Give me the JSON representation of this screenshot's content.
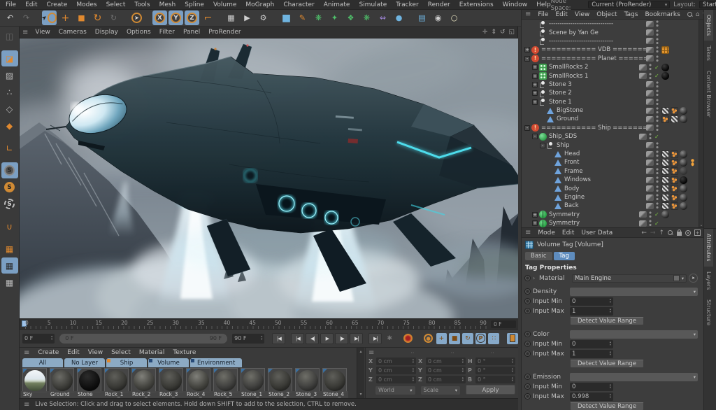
{
  "menubar": {
    "items": [
      "File",
      "Edit",
      "Create",
      "Modes",
      "Select",
      "Tools",
      "Mesh",
      "Spline",
      "Volume",
      "MoGraph",
      "Character",
      "Animate",
      "Simulate",
      "Tracker",
      "Render",
      "Extensions",
      "Window",
      "Help"
    ],
    "node_space_label": "Node Space:",
    "node_space_value": "Current (ProRender)",
    "layout_label": "Layout:",
    "layout_value": "Startup"
  },
  "toolbar": {
    "items": [
      {
        "name": "undo-icon",
        "glyph": "↶",
        "cls": ""
      },
      {
        "name": "redo-icon",
        "glyph": "↷",
        "cls": "dim"
      },
      {
        "name": "live-selection-icon",
        "glyph": "",
        "cls": "sel hl ring gap"
      },
      {
        "name": "move-icon",
        "glyph": "+",
        "cls": "org big"
      },
      {
        "name": "scale-icon",
        "glyph": "■",
        "cls": "org"
      },
      {
        "name": "rotate-icon",
        "glyph": "↻",
        "cls": "org big"
      },
      {
        "name": "last-used-tool-icon",
        "glyph": "↻",
        "cls": "dim"
      },
      {
        "name": "selection-tool-icon",
        "glyph": "➤",
        "cls": "ring gap"
      },
      {
        "name": "axis-x-lock-icon",
        "glyph": "X",
        "cls": "axis hl gap"
      },
      {
        "name": "axis-y-lock-icon",
        "glyph": "Y",
        "cls": "axis hl"
      },
      {
        "name": "axis-z-lock-icon",
        "glyph": "Z",
        "cls": "axis hl"
      },
      {
        "name": "coordinate-system-icon",
        "glyph": "⌐",
        "cls": "org big"
      },
      {
        "name": "render-view-icon",
        "glyph": "▦",
        "cls": "gap"
      },
      {
        "name": "render-picture-viewer-icon",
        "glyph": "▶",
        "cls": ""
      },
      {
        "name": "render-settings-icon",
        "glyph": "⚙",
        "cls": ""
      },
      {
        "name": "primitive-cube-icon",
        "glyph": "■",
        "cls": "blue big gap"
      },
      {
        "name": "spline-pen-icon",
        "glyph": "✎",
        "cls": "org"
      },
      {
        "name": "subdivision-surface-icon",
        "glyph": "❋",
        "cls": "green"
      },
      {
        "name": "generator-icon",
        "glyph": "✦",
        "cls": "green"
      },
      {
        "name": "deformer-icon",
        "glyph": "❖",
        "cls": "green"
      },
      {
        "name": "cloner-icon",
        "glyph": "❋",
        "cls": "green"
      },
      {
        "name": "symmetry-icon",
        "glyph": "⇔",
        "cls": "purple"
      },
      {
        "name": "volume-icon",
        "glyph": "●",
        "cls": "blue"
      },
      {
        "name": "floor-icon",
        "glyph": "▤",
        "cls": "blue gap"
      },
      {
        "name": "camera-icon",
        "glyph": "◉",
        "cls": ""
      },
      {
        "name": "light-icon",
        "glyph": "○",
        "cls": "ylw"
      }
    ]
  },
  "leftbar": {
    "items": [
      {
        "name": "make-editable-icon",
        "glyph": "◫",
        "cls": "dim"
      },
      {
        "name": "model-mode-icon",
        "glyph": "◪",
        "cls": "hl org sp"
      },
      {
        "name": "texture-mode-icon",
        "glyph": "▨",
        "cls": ""
      },
      {
        "name": "point-mode-icon",
        "glyph": "∴",
        "cls": ""
      },
      {
        "name": "edge-mode-icon",
        "glyph": "◇",
        "cls": ""
      },
      {
        "name": "polygon-mode-icon",
        "glyph": "◆",
        "cls": "org"
      },
      {
        "name": "axis-mode-icon",
        "glyph": "∟",
        "cls": "org sp"
      },
      {
        "name": "snap-enable-icon",
        "glyph": "S",
        "cls": "ringS hl sp"
      },
      {
        "name": "snap-modes-icon",
        "glyph": "S",
        "cls": "ringS org"
      },
      {
        "name": "snap-dynamic-icon",
        "glyph": "S",
        "cls": "ringS dash"
      },
      {
        "name": "magnet-icon",
        "glyph": "∪",
        "cls": "org sp"
      },
      {
        "name": "workplane-icon",
        "glyph": "▦",
        "cls": "org sp"
      },
      {
        "name": "locked-workplane-icon",
        "glyph": "▦",
        "cls": "hl"
      },
      {
        "name": "dynamic-workplane-icon",
        "glyph": "▦",
        "cls": ""
      }
    ]
  },
  "viewport": {
    "menu": [
      "View",
      "Cameras",
      "Display",
      "Options",
      "Filter",
      "Panel",
      "ProRender"
    ],
    "corner_icons": [
      {
        "name": "pan-view-icon",
        "glyph": "✛"
      },
      {
        "name": "dolly-view-icon",
        "glyph": "⇕"
      },
      {
        "name": "rotate-view-icon",
        "glyph": "↺"
      },
      {
        "name": "toggle-view-icon",
        "glyph": "◱"
      }
    ]
  },
  "objects": {
    "menu": [
      "File",
      "Edit",
      "View",
      "Object",
      "Tags",
      "Bookmarks"
    ],
    "tree": [
      {
        "ind": "ind-1",
        "expand": "",
        "icon": "ico-null",
        "label": "------------------------------",
        "check": false,
        "tags": []
      },
      {
        "ind": "ind-1",
        "expand": "",
        "icon": "ico-null",
        "label": "Scene by Yan Ge",
        "check": false,
        "tags": []
      },
      {
        "ind": "ind-1",
        "expand": "",
        "icon": "ico-null",
        "label": "------------------------------",
        "check": false,
        "tags": []
      },
      {
        "ind": "ind-0",
        "expand": "+",
        "icon": "ico-bang",
        "label": "=========== VDB ============",
        "check": false,
        "tags": [
          "tag-vol"
        ]
      },
      {
        "ind": "ind-0",
        "expand": "-",
        "icon": "ico-bang",
        "label": "=========== Planet ============",
        "check": false,
        "tags": []
      },
      {
        "ind": "ind-1",
        "expand": "+",
        "icon": "ico-cloner",
        "label": "SmallRocks 2",
        "check": true,
        "tags": [
          "tag-sphere-dark"
        ]
      },
      {
        "ind": "ind-1",
        "expand": "+",
        "icon": "ico-cloner",
        "label": "SmallRocks 1",
        "check": true,
        "tags": [
          "tag-sphere-dark"
        ]
      },
      {
        "ind": "ind-1",
        "expand": "+",
        "icon": "ico-null",
        "label": "Stone 3",
        "check": false,
        "tags": []
      },
      {
        "ind": "ind-1",
        "expand": "+",
        "icon": "ico-null",
        "label": "Stone 2",
        "check": false,
        "tags": []
      },
      {
        "ind": "ind-1",
        "expand": "+",
        "icon": "ico-null",
        "label": "Stone 1",
        "check": false,
        "tags": []
      },
      {
        "ind": "ind-2",
        "expand": "",
        "icon": "ico-poly",
        "label": "BigStone",
        "check": false,
        "tags": [
          "tag-checker",
          "tag-odots",
          "tag-sphere"
        ]
      },
      {
        "ind": "ind-2",
        "expand": "",
        "icon": "ico-poly",
        "label": "Ground",
        "check": false,
        "tags": [
          "tag-odots",
          "tag-checker",
          "tag-sphere"
        ]
      },
      {
        "ind": "ind-0",
        "expand": "-",
        "icon": "ico-bang",
        "label": "=========== Ship ============",
        "check": false,
        "tags": []
      },
      {
        "ind": "ind-1",
        "expand": "-",
        "icon": "ico-sds",
        "label": "Ship_SDS",
        "check": true,
        "tags": []
      },
      {
        "ind": "ind-2",
        "expand": "-",
        "icon": "ico-null",
        "label": "Ship",
        "check": false,
        "tags": []
      },
      {
        "ind": "ind-3",
        "expand": "",
        "icon": "ico-poly",
        "label": "Head",
        "check": false,
        "tags": [
          "tag-checker",
          "tag-odots",
          "tag-sphere"
        ]
      },
      {
        "ind": "ind-3",
        "expand": "",
        "icon": "ico-poly",
        "label": "Front",
        "check": false,
        "tags": [
          "tag-checker",
          "tag-odots",
          "tag-sphere",
          "tag-figure"
        ]
      },
      {
        "ind": "ind-3",
        "expand": "",
        "icon": "ico-poly",
        "label": "Frame",
        "check": false,
        "tags": [
          "tag-checker",
          "tag-odots",
          "tag-sphere-dim"
        ]
      },
      {
        "ind": "ind-3",
        "expand": "",
        "icon": "ico-poly",
        "label": "Windows",
        "check": false,
        "tags": [
          "tag-checker",
          "tag-odots",
          "tag-sphere-dark"
        ]
      },
      {
        "ind": "ind-3",
        "expand": "",
        "icon": "ico-poly",
        "label": "Body",
        "check": false,
        "tags": [
          "tag-checker",
          "tag-odots",
          "tag-sphere"
        ]
      },
      {
        "ind": "ind-3",
        "expand": "",
        "icon": "ico-poly",
        "label": "Engine",
        "check": false,
        "tags": [
          "tag-checker",
          "tag-odots",
          "tag-sphere"
        ]
      },
      {
        "ind": "ind-3",
        "expand": "",
        "icon": "ico-poly",
        "label": "Back",
        "check": false,
        "tags": [
          "tag-checker",
          "tag-odots",
          "tag-sphere"
        ]
      },
      {
        "ind": "ind-1",
        "expand": "+",
        "icon": "ico-sym",
        "label": "Symmetry",
        "check": true,
        "tags": [
          "tag-sphere"
        ]
      },
      {
        "ind": "ind-1",
        "expand": "+",
        "icon": "ico-sym",
        "label": "Symmetry",
        "check": true,
        "tags": []
      }
    ]
  },
  "attributes": {
    "menu": [
      "Mode",
      "Edit",
      "User Data"
    ],
    "title": "Volume Tag [Volume]",
    "tab_basic": "Basic",
    "tab_tag": "Tag",
    "section": "Tag Properties",
    "rows": [
      {
        "kind": "material",
        "label": "Material",
        "value": "Main Engine",
        "radio": true,
        "arrow": true,
        "gap": false
      },
      {
        "kind": "select",
        "label": "Density",
        "radio": true,
        "gap": true
      },
      {
        "kind": "number",
        "label": "Input Min",
        "value": "0",
        "radio": true,
        "gap": false
      },
      {
        "kind": "number",
        "label": "Input Max",
        "value": "1",
        "radio": true,
        "gap": false
      },
      {
        "kind": "button",
        "value": "Detect Value Range",
        "gap": false
      },
      {
        "kind": "select",
        "label": "Color",
        "radio": true,
        "gap": true
      },
      {
        "kind": "number",
        "label": "Input Min",
        "value": "0",
        "radio": true,
        "gap": false
      },
      {
        "kind": "number",
        "label": "Input Max",
        "value": "1",
        "radio": true,
        "gap": false
      },
      {
        "kind": "button",
        "value": "Detect Value Range",
        "gap": false
      },
      {
        "kind": "select",
        "label": "Emission",
        "radio": true,
        "gap": true
      },
      {
        "kind": "number",
        "label": "Input Min",
        "value": "0",
        "radio": true,
        "gap": false
      },
      {
        "kind": "number",
        "label": "Input Max",
        "value": "0.998",
        "radio": true,
        "gap": false
      },
      {
        "kind": "button",
        "value": "Detect Value Range",
        "gap": false
      }
    ]
  },
  "timeline": {
    "labels": [
      "0",
      "5",
      "10",
      "15",
      "20",
      "25",
      "30",
      "35",
      "40",
      "45",
      "50",
      "55",
      "60",
      "65",
      "70",
      "75",
      "80",
      "85",
      "90"
    ],
    "end_field": "0 F",
    "current": "0 F",
    "range_start": "0 F",
    "range_end": "90 F",
    "range_field": "90 F"
  },
  "transport": [
    {
      "name": "go-to-start-button",
      "glyph": "|◀",
      "cls": "first"
    },
    {
      "name": "previous-key-button",
      "glyph": "|◀",
      "cls": ""
    },
    {
      "name": "previous-frame-button",
      "glyph": "◀|",
      "cls": ""
    },
    {
      "name": "play-button",
      "glyph": "▶",
      "cls": ""
    },
    {
      "name": "next-frame-button",
      "glyph": "|▶",
      "cls": ""
    },
    {
      "name": "next-key-button",
      "glyph": "▶|",
      "cls": ""
    },
    {
      "name": "go-to-end-button",
      "glyph": "▶|",
      "cls": "last"
    }
  ],
  "materials": {
    "menu": [
      "Create",
      "Edit",
      "View",
      "Select",
      "Material",
      "Texture"
    ],
    "layers": [
      {
        "label": "All",
        "marker": ""
      },
      {
        "label": "No Layer",
        "marker": ""
      },
      {
        "label": "Ship",
        "marker": "org"
      },
      {
        "label": "Volume",
        "marker": "blue"
      },
      {
        "label": "Environment",
        "marker": "blue"
      }
    ],
    "items": [
      {
        "name": "Sky",
        "cls": "mat-sky"
      },
      {
        "name": "Ground",
        "cls": "mat-dark"
      },
      {
        "name": "Stone",
        "cls": "mat-black"
      },
      {
        "name": "Rock_1",
        "cls": "mat-rock-b"
      },
      {
        "name": "Rock_2",
        "cls": "mat-rock-a"
      },
      {
        "name": "Rock_3",
        "cls": "mat-rock-b"
      },
      {
        "name": "Rock_4",
        "cls": "mat-rock-a"
      },
      {
        "name": "Rock_5",
        "cls": "mat-rock-c"
      },
      {
        "name": "Stone_1",
        "cls": "mat-rock-c"
      },
      {
        "name": "Stone_2",
        "cls": "mat-rock-b"
      },
      {
        "name": "Stone_3",
        "cls": "mat-rock-c"
      },
      {
        "name": "Stone_4",
        "cls": "mat-rock-b"
      }
    ]
  },
  "coords": {
    "headers": [
      "··",
      "··",
      "··"
    ],
    "rows": [
      {
        "l1": "X",
        "v1": "0 cm",
        "l2": "X",
        "v2": "0 cm",
        "l3": "H",
        "v3": "0 °"
      },
      {
        "l1": "Y",
        "v1": "0 cm",
        "l2": "Y",
        "v2": "0 cm",
        "l3": "P",
        "v3": "0 °"
      },
      {
        "l1": "Z",
        "v1": "0 cm",
        "l2": "Z",
        "v2": "0 cm",
        "l3": "B",
        "v3": "0 °"
      }
    ],
    "mode1": "World",
    "mode2": "Scale",
    "apply": "Apply"
  },
  "status": {
    "text": "Live Selection: Click and drag to select elements. Hold down SHIFT to add to the selection, CTRL to remove."
  },
  "side_tabs": {
    "top": [
      {
        "label": "Objects",
        "active": true
      },
      {
        "label": "Takes",
        "active": false
      },
      {
        "label": "Content Browser",
        "active": false
      }
    ],
    "bottom": [
      {
        "label": "Attributes",
        "active": true
      },
      {
        "label": "Layers",
        "active": false
      },
      {
        "label": "Structure",
        "active": false
      }
    ]
  },
  "colors": {
    "accent_orange": "#e0892f",
    "highlight_blue": "#7b9fc3",
    "tab_blue": "#5e8cbe",
    "engine_cyan": "#5feeff",
    "check_green": "#7ac142"
  }
}
